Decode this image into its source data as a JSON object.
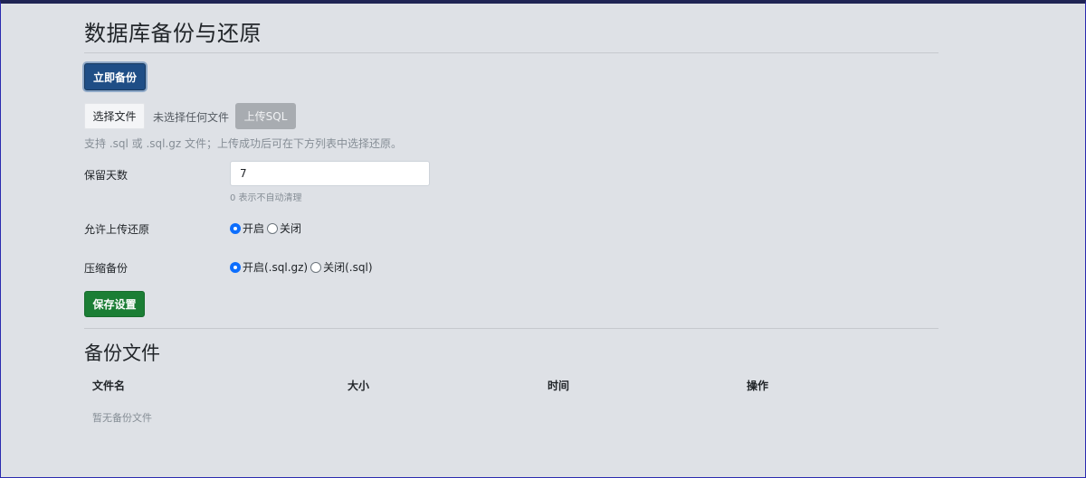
{
  "page": {
    "title": "数据库备份与还原"
  },
  "actions": {
    "backup_now": "立即备份"
  },
  "upload": {
    "choose_file": "选择文件",
    "file_status": "未选择任何文件",
    "upload_button": "上传SQL",
    "hint": "支持 .sql 或 .sql.gz 文件；上传成功后可在下方列表中选择还原。"
  },
  "settings": {
    "retention_days": {
      "label": "保留天数",
      "value": "7",
      "hint": "0 表示不自动清理"
    },
    "allow_upload_restore": {
      "label": "允许上传还原",
      "options": [
        {
          "label": "开启",
          "checked": true
        },
        {
          "label": "关闭",
          "checked": false
        }
      ]
    },
    "compress_backup": {
      "label": "压缩备份",
      "options": [
        {
          "label": "开启(.sql.gz)",
          "checked": true
        },
        {
          "label": "关闭(.sql)",
          "checked": false
        }
      ]
    },
    "save_button": "保存设置"
  },
  "backups": {
    "title": "备份文件",
    "columns": [
      "文件名",
      "大小",
      "时间",
      "操作"
    ],
    "empty_text": "暂无备份文件"
  },
  "colors": {
    "primary": "#1f4e86",
    "success": "#1b7e35",
    "radio_accent": "#0d6efd",
    "background": "#dee1e6"
  }
}
